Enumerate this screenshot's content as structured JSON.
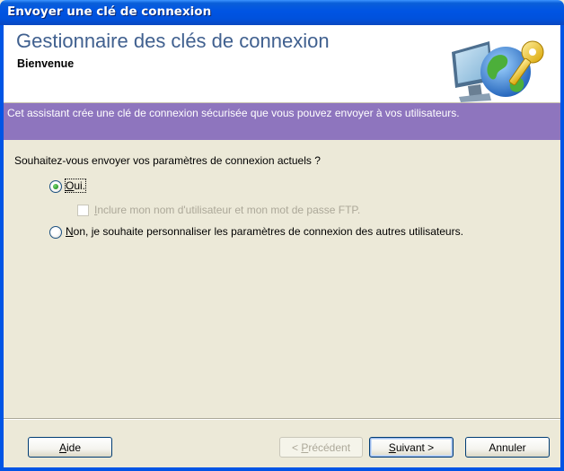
{
  "window": {
    "title": "Envoyer une clé de connexion"
  },
  "header": {
    "title": "Gestionnaire des clés de connexion",
    "subtitle": "Bienvenue",
    "logo_icon": "computer-globe-key-icon"
  },
  "banner": {
    "text": "Cet assistant crée une clé de connexion sécurisée que vous pouvez envoyer à vos utilisateurs.",
    "color": "#8e75be"
  },
  "form": {
    "question": "Souhaitez-vous envoyer vos paramètres de connexion actuels ?",
    "option_yes": {
      "mnemonic": "O",
      "rest": "ui.",
      "selected": true
    },
    "option_no": {
      "mnemonic": "N",
      "rest": "on, je souhaite personnaliser les paramètres de connexion des autres utilisateurs.",
      "selected": false
    },
    "include_credentials": {
      "mnemonic": "I",
      "rest": "nclure mon nom d'utilisateur et mon mot de passe FTP.",
      "checked": false,
      "enabled": false
    }
  },
  "buttons": {
    "help": {
      "prefix": "",
      "mnemonic": "A",
      "rest": "ide"
    },
    "previous": {
      "prefix": "< ",
      "mnemonic": "P",
      "rest": "récédent",
      "enabled": false
    },
    "next": {
      "prefix": "",
      "mnemonic": "S",
      "rest": "uivant >"
    },
    "cancel": {
      "label": "Annuler"
    }
  },
  "colors": {
    "title_bar": "#0054e3",
    "header_title": "#40608f",
    "dialog_bg": "#ece9d8"
  }
}
